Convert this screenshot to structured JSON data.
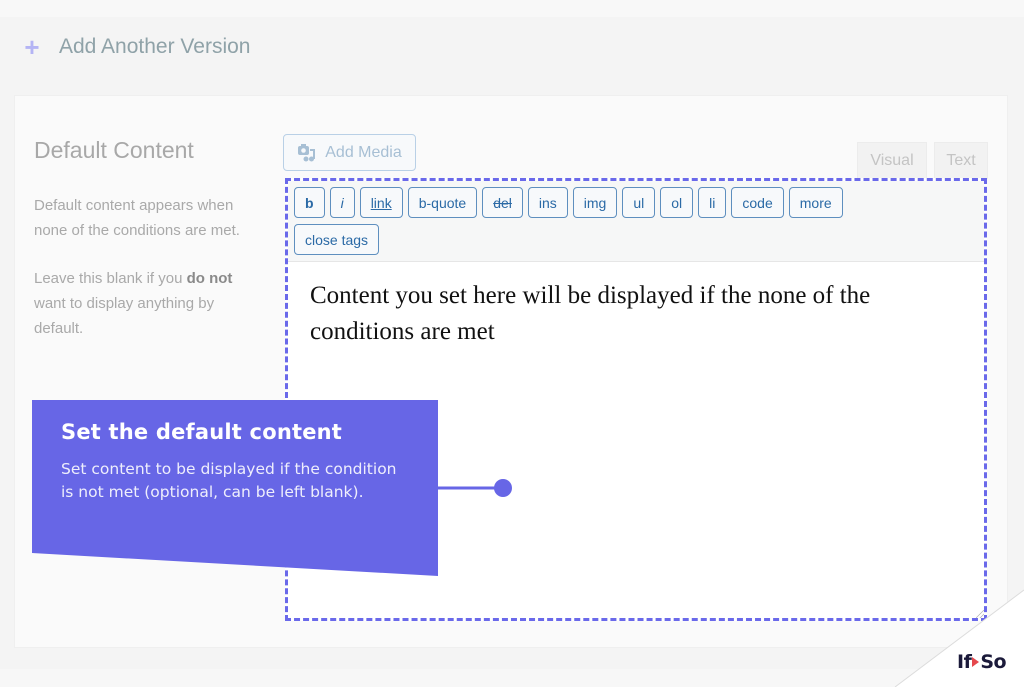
{
  "add_version": {
    "icon": "plus-icon",
    "label": "Add Another Version"
  },
  "sidebar": {
    "title": "Default Content",
    "desc1": "Default content appears when none of the conditions are met.",
    "desc2_pre": "Leave this blank if you ",
    "desc2_bold1": "do",
    "desc2_bold2": "not",
    "desc2_post": " want to display anything by default."
  },
  "editor": {
    "add_media_label": "Add Media",
    "tabs": [
      {
        "label": "Visual",
        "active": false
      },
      {
        "label": "Text",
        "active": true
      }
    ],
    "quicktags_row1": [
      "b",
      "i",
      "link",
      "b-quote",
      "del",
      "ins",
      "img",
      "ul",
      "ol",
      "li",
      "code",
      "more"
    ],
    "quicktags_row2": [
      "close tags"
    ],
    "content": "Content you set here will be displayed if the none of the conditions are met"
  },
  "callout": {
    "title": "Set the default content",
    "body": "Set content to be displayed if the condition is not met (optional, can be left blank).",
    "color": "#6766e6"
  },
  "logo": {
    "left": "If",
    "right": "So"
  }
}
